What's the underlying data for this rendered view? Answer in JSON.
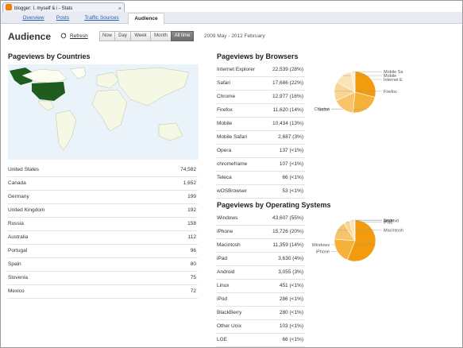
{
  "browser_tab": {
    "title": "blogger: I, myself & i - Stats",
    "close": "×"
  },
  "nav": {
    "tabs": [
      "Overview",
      "Posts",
      "Traffic Sources",
      "Audience"
    ],
    "active": 3
  },
  "header": {
    "title": "Audience",
    "refresh_label": "Refresh",
    "ranges": [
      "Now",
      "Day",
      "Week",
      "Month",
      "All time"
    ],
    "selected_range": "All time",
    "date_range": "2009 May - 2012 February"
  },
  "countries": {
    "title": "Pageviews by Countries",
    "rows": [
      {
        "label": "United States",
        "value": "74,582"
      },
      {
        "label": "Canada",
        "value": "1,652"
      },
      {
        "label": "Germany",
        "value": "199"
      },
      {
        "label": "United Kingdom",
        "value": "192"
      },
      {
        "label": "Russia",
        "value": "158"
      },
      {
        "label": "Australia",
        "value": "112"
      },
      {
        "label": "Portugal",
        "value": "96"
      },
      {
        "label": "Spain",
        "value": "80"
      },
      {
        "label": "Slovenia",
        "value": "75"
      },
      {
        "label": "Mexico",
        "value": "72"
      }
    ]
  },
  "browsers": {
    "title": "Pageviews by Browsers",
    "rows": [
      {
        "label": "Internet Explorer",
        "value": "22,539 (28%)"
      },
      {
        "label": "Safari",
        "value": "17,686 (22%)"
      },
      {
        "label": "Chrome",
        "value": "12,977 (16%)"
      },
      {
        "label": "Firefox",
        "value": "11,620 (14%)"
      },
      {
        "label": "Mobile",
        "value": "10,434 (13%)"
      },
      {
        "label": "Mobile Safari",
        "value": "2,687 (3%)"
      },
      {
        "label": "Opera",
        "value": "137 (<1%)"
      },
      {
        "label": "chromeframe",
        "value": "107 (<1%)"
      },
      {
        "label": "Teleca",
        "value": "66 (<1%)"
      },
      {
        "label": "wOSBrowser",
        "value": "53 (<1%)"
      }
    ],
    "pie": {
      "slices": [
        {
          "label": "Internet E",
          "value": 22539,
          "color": "#f29b0c"
        },
        {
          "label": "Safari",
          "value": 17686,
          "color": "#f6b13a"
        },
        {
          "label": "Chrome",
          "value": 12977,
          "color": "#f8c46a"
        },
        {
          "label": "Firefox",
          "value": 11620,
          "color": "#fad695"
        },
        {
          "label": "Mobile",
          "value": 10434,
          "color": "#fbe3b8"
        },
        {
          "label": "Mobile Sa",
          "value": 2687,
          "color": "#fdf0d8"
        }
      ]
    }
  },
  "os": {
    "title": "Pageviews by Operating Systems",
    "rows": [
      {
        "label": "Windows",
        "value": "43,607 (55%)"
      },
      {
        "label": "iPhone",
        "value": "15,726 (20%)"
      },
      {
        "label": "Macintosh",
        "value": "11,359 (14%)"
      },
      {
        "label": "iPad",
        "value": "3,630 (4%)"
      },
      {
        "label": "Android",
        "value": "3,055 (3%)"
      },
      {
        "label": "Linux",
        "value": "451 (<1%)"
      },
      {
        "label": "iPod",
        "value": "286 (<1%)"
      },
      {
        "label": "BlackBerry",
        "value": "280 (<1%)"
      },
      {
        "label": "Other Unix",
        "value": "103 (<1%)"
      },
      {
        "label": "LGE",
        "value": "66 (<1%)"
      }
    ],
    "pie": {
      "slices": [
        {
          "label": "Windows",
          "value": 43607,
          "color": "#f29b0c"
        },
        {
          "label": "iPhone",
          "value": 15726,
          "color": "#f6b13a"
        },
        {
          "label": "Macintosh",
          "value": 11359,
          "color": "#f8c46a"
        },
        {
          "label": "iPad",
          "value": 3630,
          "color": "#fad695"
        },
        {
          "label": "Android",
          "value": 3055,
          "color": "#fbe3b8"
        },
        {
          "label": "Linux",
          "value": 451,
          "color": "#fdf0d8"
        }
      ]
    }
  }
}
